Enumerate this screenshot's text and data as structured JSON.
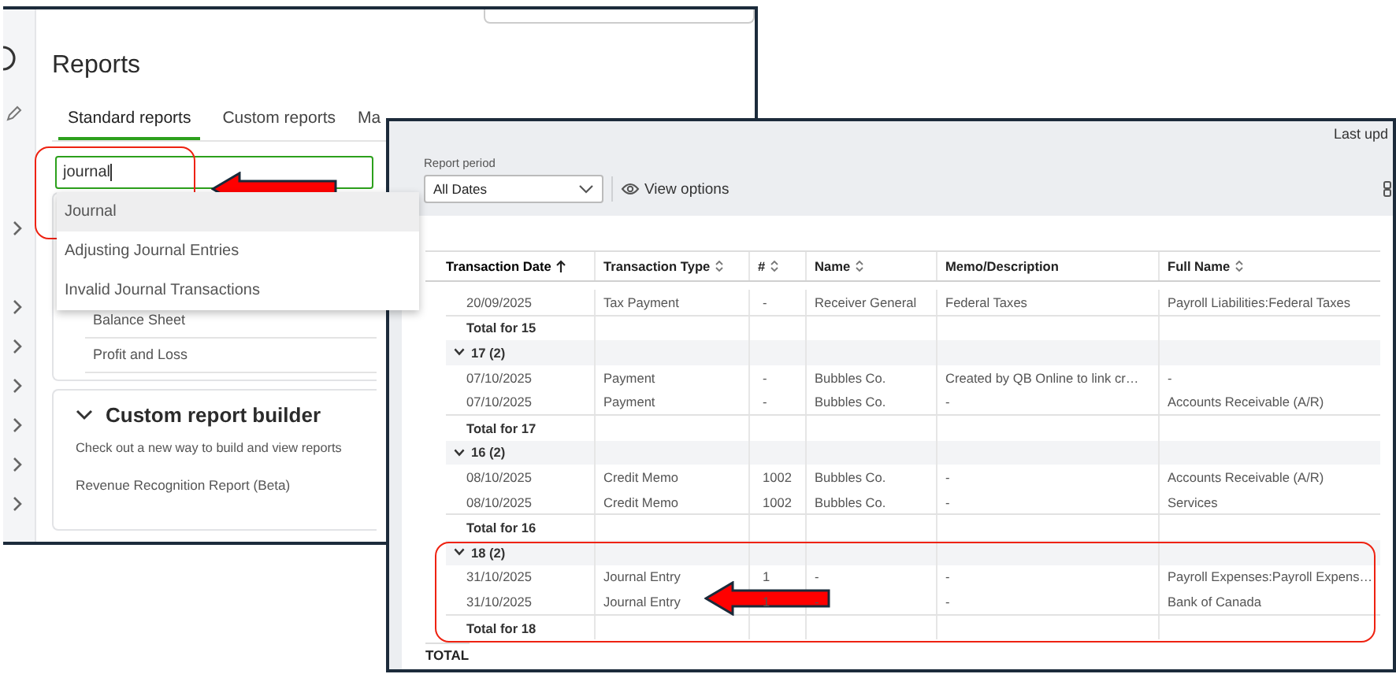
{
  "reports_window": {
    "title": "Reports",
    "tabs": [
      {
        "label": "Standard reports",
        "selected": true
      },
      {
        "label": "Custom reports",
        "selected": false
      },
      {
        "label": "Ma",
        "selected": false
      }
    ],
    "search": {
      "value": "journal"
    },
    "suggestions": [
      {
        "label": "Journal",
        "selected": true
      },
      {
        "label": "Adjusting Journal Entries",
        "selected": false
      },
      {
        "label": "Invalid Journal Transactions",
        "selected": false
      }
    ],
    "report_list": [
      "Balance Sheet",
      "Profit and Loss"
    ],
    "custom_builder": {
      "title": "Custom report builder",
      "expanded": true,
      "description": "Check out a new way to build and view reports",
      "reports": [
        "Revenue Recognition Report (Beta)"
      ]
    }
  },
  "report_window": {
    "last_updated": "Last upd",
    "report_period": {
      "label": "Report period",
      "value": "All Dates"
    },
    "view_options": "View options",
    "table": {
      "columns": [
        {
          "label": "Transaction Date",
          "sortable": true,
          "sorted": true
        },
        {
          "label": "Transaction Type",
          "sortable": true,
          "sorted": false
        },
        {
          "label": "#",
          "sortable": true,
          "sorted": false
        },
        {
          "label": "Name",
          "sortable": true,
          "sorted": false
        },
        {
          "label": "Memo/Description",
          "sortable": false,
          "sorted": false
        },
        {
          "label": "Full Name",
          "sortable": true,
          "sorted": false
        }
      ],
      "rows": [
        {
          "kind": "row",
          "cells": [
            "20/09/2025",
            "Tax Payment",
            "-",
            "Receiver General",
            "Federal Taxes",
            "Payroll Liabilities:Federal Taxes"
          ]
        },
        {
          "kind": "total",
          "label": "Total for 15"
        },
        {
          "kind": "group",
          "label": "17 (2)",
          "expanded": true
        },
        {
          "kind": "row",
          "cells": [
            "07/10/2025",
            "Payment",
            "-",
            "Bubbles Co.",
            "Created by QB Online to link cr…",
            "-"
          ]
        },
        {
          "kind": "row",
          "cells": [
            "07/10/2025",
            "Payment",
            "-",
            "Bubbles Co.",
            "-",
            "Accounts Receivable (A/R)"
          ]
        },
        {
          "kind": "total",
          "label": "Total for 17"
        },
        {
          "kind": "group",
          "label": "16 (2)",
          "expanded": true
        },
        {
          "kind": "row",
          "cells": [
            "08/10/2025",
            "Credit Memo",
            "1002",
            "Bubbles Co.",
            "-",
            "Accounts Receivable (A/R)"
          ]
        },
        {
          "kind": "row",
          "cells": [
            "08/10/2025",
            "Credit Memo",
            "1002",
            "Bubbles Co.",
            "-",
            "Services"
          ]
        },
        {
          "kind": "total",
          "label": "Total for 16"
        },
        {
          "kind": "group",
          "label": "18 (2)",
          "expanded": true
        },
        {
          "kind": "row",
          "cells": [
            "31/10/2025",
            "Journal Entry",
            "1",
            "-",
            "-",
            "Payroll Expenses:Payroll Expens…"
          ]
        },
        {
          "kind": "row",
          "cells": [
            "31/10/2025",
            "Journal Entry",
            "1",
            "-",
            "-",
            "Bank of Canada"
          ]
        },
        {
          "kind": "total",
          "label": "Total for 18"
        }
      ],
      "grand_total": "TOTAL"
    }
  }
}
